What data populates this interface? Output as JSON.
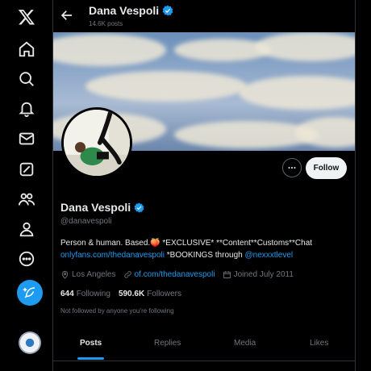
{
  "nav": {
    "items": [
      "x-logo",
      "home-icon",
      "explore-icon",
      "notifications-icon",
      "messages-icon",
      "grok-icon",
      "communities-icon",
      "profile-icon",
      "more-icon"
    ]
  },
  "header": {
    "name": "Dana Vespoli",
    "posts_count": "14.6K posts"
  },
  "profile": {
    "name": "Dana Vespoli",
    "handle": "@danavespoli",
    "follow_label": "Follow",
    "bio_line1": "Person & human. Based.🍑 *EXCLUSIVE* **Content**Customs**Chat",
    "bio_link1": "onlyfans.com/thedanavespoli",
    "bio_line2_mid": " *BOOKINGS through ",
    "bio_link2": "@nexxxtlevel",
    "location": "Los Angeles",
    "website": "of.com/thedanavespoli",
    "joined": "Joined July 2011",
    "following_count": "644",
    "following_label": "Following",
    "followers_count": "590.6K",
    "followers_label": "Followers",
    "not_followed": "Not followed by anyone you’re following"
  },
  "tabs": [
    {
      "label": "Posts",
      "active": true
    },
    {
      "label": "Replies",
      "active": false
    },
    {
      "label": "Media",
      "active": false
    },
    {
      "label": "Likes",
      "active": false
    }
  ],
  "colors": {
    "accent": "#1d9bf0",
    "background": "#000000",
    "text": "#e7e9ea",
    "muted": "#71767b"
  }
}
